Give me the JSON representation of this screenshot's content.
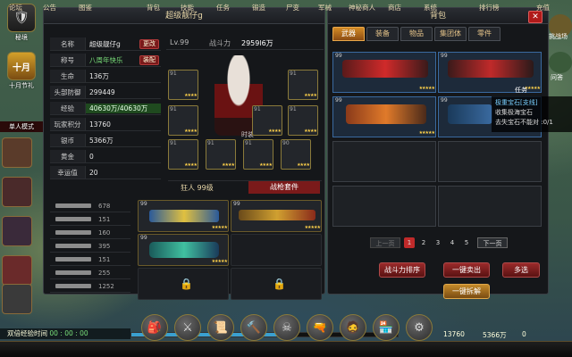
{
  "left_strip": {
    "items": [
      {
        "label": "秘境",
        "icon": "shield-icon"
      },
      {
        "label": "十月节礼",
        "icon": "gift-icon",
        "big": "十月"
      }
    ],
    "mode_label": "单人模式"
  },
  "panel": {
    "title": "超级靓仔g",
    "info": [
      {
        "k": "名称",
        "v": "超级靓仔g",
        "btn": "更改"
      },
      {
        "k": "称号",
        "v": "八周年快乐",
        "btn": "装配"
      },
      {
        "k": "生命",
        "v": "136万"
      },
      {
        "k": "头部防御",
        "v": "299449"
      },
      {
        "k": "经验",
        "v": "40630万/40630万"
      },
      {
        "k": "玩家积分",
        "v": "13760"
      },
      {
        "k": "银币",
        "v": "5366万"
      },
      {
        "k": "黄金",
        "v": "0"
      },
      {
        "k": "幸运值",
        "v": "20"
      }
    ],
    "level": "Lv.99",
    "power_label": "战斗力",
    "power_value": "2959l6万",
    "slots": [
      {
        "n": "91"
      },
      {
        "n": "91"
      },
      {
        "n": "91"
      },
      {
        "n": "91"
      },
      {
        "n": "91"
      },
      {
        "n": "91"
      },
      {
        "n": "91"
      },
      {
        "n": "90"
      },
      {
        "n": "91"
      }
    ],
    "fashion_label": "时装",
    "rank": "狂人 99级",
    "equip_tab": "战枪套件",
    "guns": [
      {
        "v": "678"
      },
      {
        "v": "151"
      },
      {
        "v": "160"
      },
      {
        "v": "395"
      },
      {
        "v": "151"
      },
      {
        "v": "255"
      },
      {
        "v": "1252"
      }
    ],
    "weapon_lv": [
      "99",
      "99",
      "99"
    ]
  },
  "bag": {
    "title": "背包",
    "close": "✕",
    "tabs": [
      "武器",
      "装备",
      "物品",
      "集团体",
      "零件"
    ],
    "cells": [
      {
        "lv": "99"
      },
      {
        "lv": "99"
      },
      {
        "lv": "99"
      },
      {
        "lv": "99"
      }
    ],
    "tooltip": {
      "title": "极重宝石[支线]",
      "line1": "收集极海宝石",
      "line2": "去失宝石不能对 :0/1"
    },
    "pages": [
      "上一页",
      "1",
      "2",
      "3",
      "4",
      "5",
      "下一页"
    ],
    "buttons": {
      "sort": "战斗力排序",
      "sell": "一键卖出",
      "multi": "多选",
      "split": "一键拆解"
    }
  },
  "right_side": {
    "labels": [
      "挑战场",
      "问答",
      "任务"
    ]
  },
  "status": {
    "exp_label": "双倍经验时间",
    "exp_time": "00 : 00 : 00",
    "exp_fraction": 0.6
  },
  "bottom": {
    "items": [
      "论坛",
      "公告",
      "图鉴",
      "背包",
      "技能",
      "任务",
      "锻造",
      "尸变",
      "军械",
      "神秘商人",
      "商店",
      "系统",
      "排行榜",
      "充值"
    ],
    "currency1": "13760",
    "currency2": "5366万",
    "currency3": "0"
  },
  "colors": {
    "accent": "#d38b26",
    "danger": "#9a2a2a",
    "panel": "#15171a"
  }
}
